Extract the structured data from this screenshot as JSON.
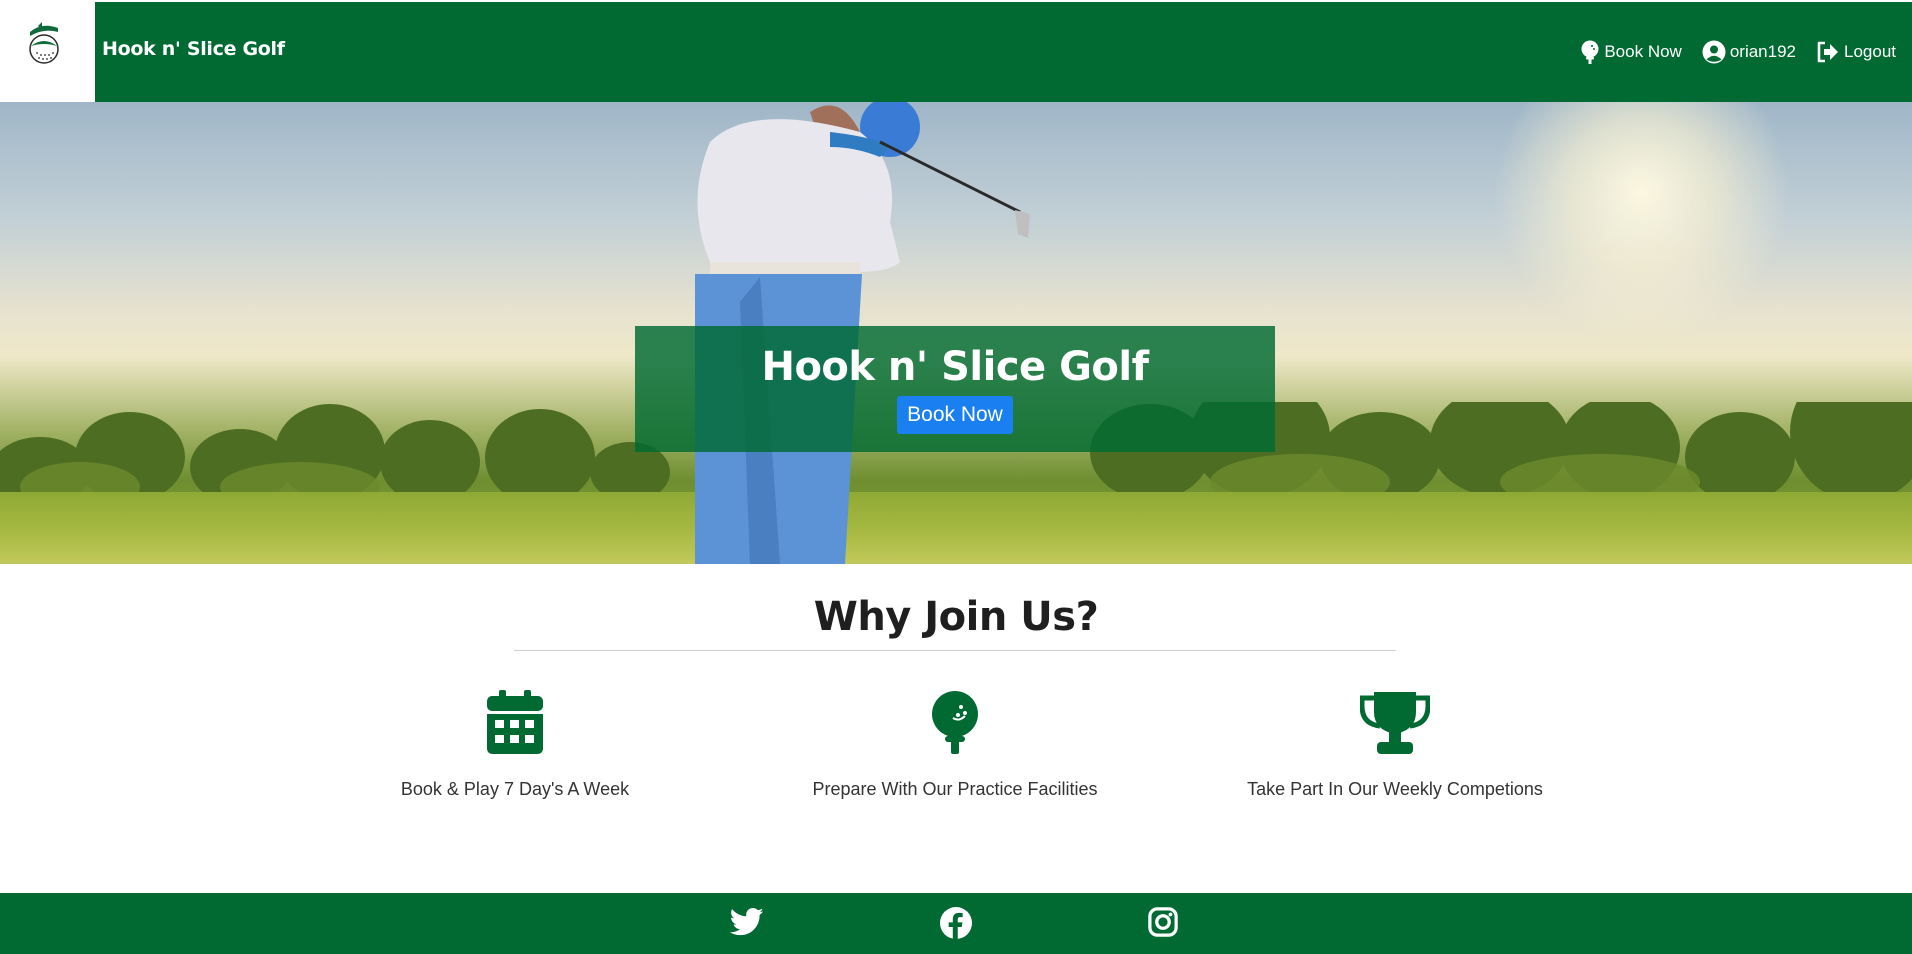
{
  "navbar": {
    "brand": "Hook n' Slice Golf",
    "links": [
      {
        "label": "Book Now",
        "icon": "golf-ball-tee-icon"
      },
      {
        "label": "orian192",
        "icon": "user-circle-icon"
      },
      {
        "label": "Logout",
        "icon": "sign-out-icon"
      }
    ]
  },
  "hero": {
    "title": "Hook n' Slice Golf",
    "button": "Book Now"
  },
  "why": {
    "title": "Why Join Us?",
    "features": [
      {
        "label": "Book & Play 7 Day's A Week",
        "icon": "calendar-icon"
      },
      {
        "label": "Prepare With Our Practice Facilities",
        "icon": "golf-ball-tee-icon"
      },
      {
        "label": "Take Part In Our Weekly Competions",
        "icon": "trophy-icon"
      }
    ]
  },
  "footer": {
    "social": [
      "twitter-icon",
      "facebook-icon",
      "instagram-icon"
    ]
  },
  "colors": {
    "brand_green": "#006a32",
    "button_blue": "#1a7ff0"
  }
}
